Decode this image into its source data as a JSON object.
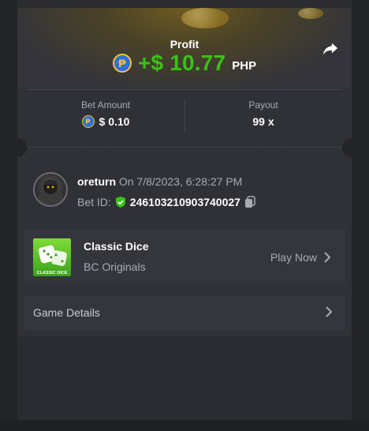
{
  "profit": {
    "label": "Profit",
    "value": "+$ 10.77",
    "currency": "PHP",
    "currency_icon": "₱"
  },
  "stats": {
    "bet_amount_label": "Bet Amount",
    "bet_amount_value": "$ 0.10",
    "payout_label": "Payout",
    "payout_value": "99 x"
  },
  "user": {
    "name": "oreturn",
    "timestamp": "On 7/8/2023, 6:28:27 PM",
    "bet_id_label": "Bet ID:",
    "bet_id": "246103210903740027"
  },
  "game": {
    "title": "Classic Dice",
    "subtitle": "BC Originals",
    "thumb_label": "CLASSIC DICE",
    "play_label": "Play Now"
  },
  "details": {
    "label": "Game Details"
  },
  "colors": {
    "profit_green": "#3bc117",
    "panel": "#2f3137",
    "muted": "#a8abb3"
  },
  "icons": {
    "share": "share-icon",
    "copy": "copy-icon",
    "verified": "shield-check-icon",
    "chevron": "chevron-right-icon"
  }
}
